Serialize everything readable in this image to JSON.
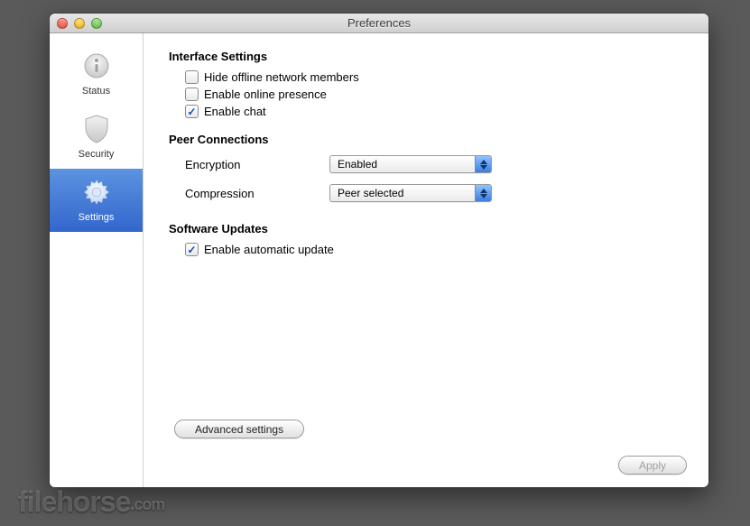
{
  "window": {
    "title": "Preferences"
  },
  "sidebar": {
    "items": [
      {
        "label": "Status"
      },
      {
        "label": "Security"
      },
      {
        "label": "Settings"
      }
    ],
    "selectedIndex": 2
  },
  "sections": {
    "interface": {
      "heading": "Interface Settings",
      "hideOffline": {
        "label": "Hide offline network members",
        "checked": false
      },
      "onlinePresence": {
        "label": "Enable online presence",
        "checked": false
      },
      "enableChat": {
        "label": "Enable chat",
        "checked": true
      }
    },
    "peer": {
      "heading": "Peer Connections",
      "encryption": {
        "label": "Encryption",
        "value": "Enabled"
      },
      "compression": {
        "label": "Compression",
        "value": "Peer selected"
      }
    },
    "updates": {
      "heading": "Software Updates",
      "autoUpdate": {
        "label": "Enable automatic update",
        "checked": true
      }
    }
  },
  "buttons": {
    "advanced": "Advanced settings",
    "apply": "Apply"
  },
  "watermark": {
    "main": "filehorse",
    "suffix": ".com"
  }
}
